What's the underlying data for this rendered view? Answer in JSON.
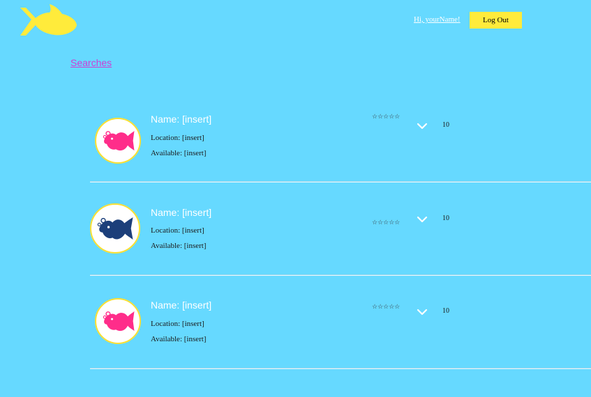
{
  "header": {
    "logo_icon": "fish-logo-icon",
    "greeting": "Hi, yourName!",
    "logout_label": "Log Out"
  },
  "nav": {
    "searches_link": "Searches"
  },
  "colors": {
    "background": "#66d9ff",
    "accent_yellow": "#ffeb3b",
    "link_purple": "#cc3fd4",
    "fish_pink": "#ff2d8a",
    "fish_navy": "#1c3f7a"
  },
  "results": [
    {
      "name": "Name: [insert]",
      "location": "Location: [insert]",
      "available": "Available: [insert]",
      "rating": "☆☆☆☆☆",
      "count": "10",
      "avatar_icon": "pink-fish-icon"
    },
    {
      "name": "Name: [insert]",
      "location": "Location: [insert]",
      "available": "Available: [insert]",
      "rating": "☆☆☆☆☆",
      "count": "10",
      "avatar_icon": "navy-fish-icon"
    },
    {
      "name": "Name: [insert]",
      "location": "Location: [insert]",
      "available": "Available: [insert]",
      "rating": "☆☆☆☆☆",
      "count": "10",
      "avatar_icon": "pink-fish-icon"
    }
  ]
}
